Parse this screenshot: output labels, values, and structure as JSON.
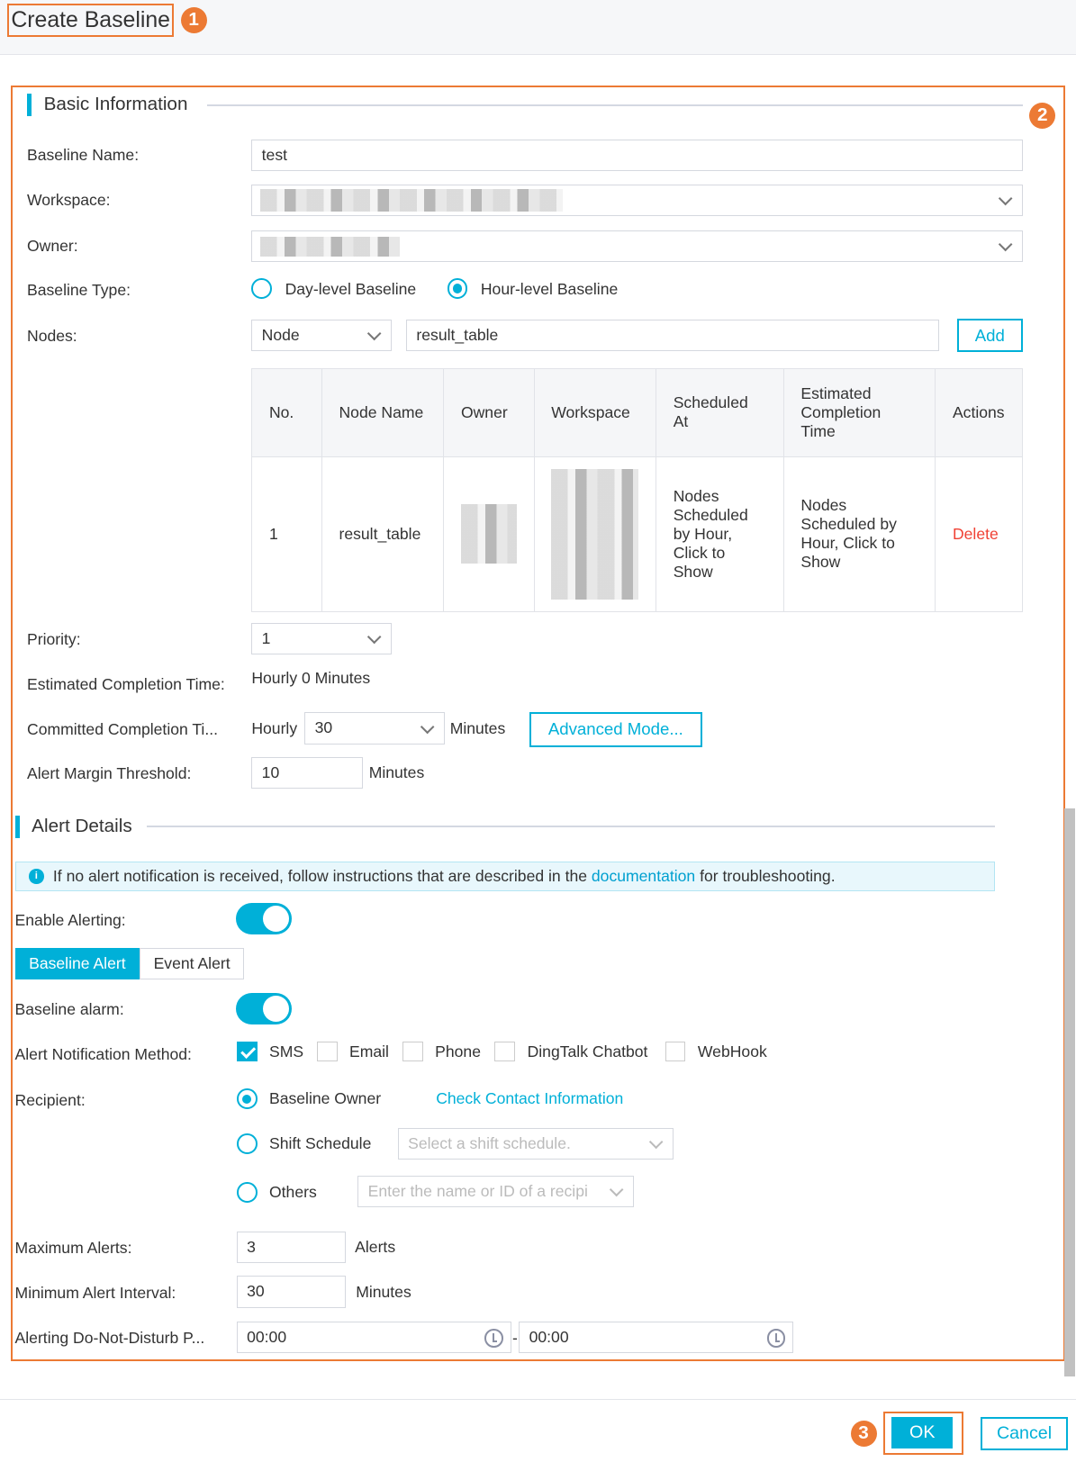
{
  "dialog": {
    "title": "Create Baseline",
    "callouts": [
      "1",
      "2",
      "3"
    ]
  },
  "basic": {
    "section_title": "Basic Information",
    "baseline_name_label": "Baseline Name:",
    "baseline_name_value": "test",
    "workspace_label": "Workspace:",
    "owner_label": "Owner:",
    "baseline_type_label": "Baseline Type:",
    "type_options": [
      "Day-level Baseline",
      "Hour-level Baseline"
    ],
    "type_selected": "Hour-level Baseline",
    "nodes_label": "Nodes:",
    "node_type": "Node",
    "node_search_value": "result_table",
    "add_label": "Add",
    "table": {
      "headers": [
        "No.",
        "Node Name",
        "Owner",
        "Workspace",
        "Scheduled At",
        "Estimated Completion Time",
        "Actions"
      ],
      "rows": [
        {
          "no": "1",
          "node_name": "result_table",
          "scheduled_at": "Nodes Scheduled by Hour, Click to Show",
          "estimated": "Nodes Scheduled by Hour, Click to Show",
          "action": "Delete"
        }
      ]
    },
    "priority_label": "Priority:",
    "priority_value": "1",
    "est_label": "Estimated Completion Time:",
    "est_value": "Hourly 0 Minutes",
    "committed_label": "Committed Completion Ti...",
    "committed_prefix": "Hourly",
    "committed_value": "30",
    "committed_unit": "Minutes",
    "advanced_label": "Advanced Mode...",
    "margin_label": "Alert Margin Threshold:",
    "margin_value": "10",
    "margin_unit": "Minutes"
  },
  "alert": {
    "section_title": "Alert Details",
    "notice_pre": "If no alert notification is received, follow instructions that are described in the ",
    "notice_link": "documentation",
    "notice_post": " for troubleshooting.",
    "enable_label": "Enable Alerting:",
    "enable_on": true,
    "tabs": [
      "Baseline Alert",
      "Event Alert"
    ],
    "active_tab": "Baseline Alert",
    "alarm_label": "Baseline alarm:",
    "alarm_on": true,
    "method_label": "Alert Notification Method:",
    "methods": [
      {
        "label": "SMS",
        "checked": true
      },
      {
        "label": "Email",
        "checked": false
      },
      {
        "label": "Phone",
        "checked": false
      },
      {
        "label": "DingTalk Chatbot",
        "checked": false
      },
      {
        "label": "WebHook",
        "checked": false
      }
    ],
    "recipient_label": "Recipient:",
    "recipient_options": [
      "Baseline Owner",
      "Shift Schedule",
      "Others"
    ],
    "recipient_selected": "Baseline Owner",
    "check_contact": "Check Contact Information",
    "shift_placeholder": "Select a shift schedule.",
    "others_placeholder": "Enter the name or ID of a recipi",
    "max_label": "Maximum Alerts:",
    "max_value": "3",
    "max_unit": "Alerts",
    "interval_label": "Minimum Alert Interval:",
    "interval_value": "30",
    "interval_unit": "Minutes",
    "dnd_label": "Alerting Do-Not-Disturb P...",
    "dnd_start": "00:00",
    "dnd_sep": "-",
    "dnd_end": "00:00"
  },
  "footer": {
    "ok": "OK",
    "cancel": "Cancel"
  },
  "colors": {
    "accent": "#00b0d8",
    "callout": "#ec7a34",
    "danger": "#f04134"
  }
}
